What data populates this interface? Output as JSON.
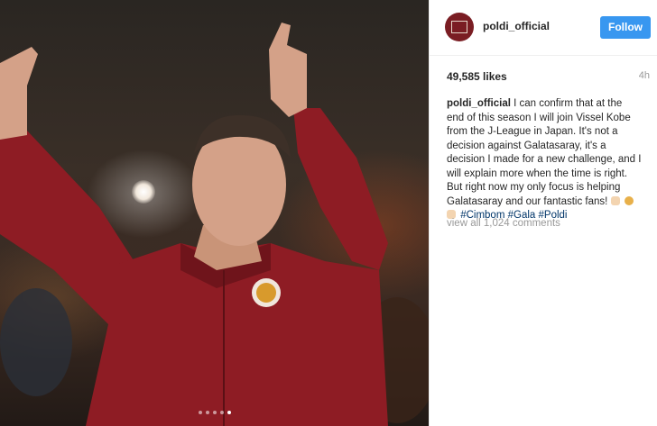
{
  "post": {
    "image_alt": "Man in red Galatasaray track jacket giving two thumbs up in a stadium",
    "carousel_dots": 5,
    "carousel_active": 5
  },
  "header": {
    "username": "poldi_official",
    "follow_label": "Follow"
  },
  "stats": {
    "likes": "49,585 likes",
    "time": "4h"
  },
  "caption": {
    "username": "poldi_official",
    "text": "I can confirm that at the end of this season I will join Vissel Kobe from the J-League in Japan. It's not a decision against Galatasaray, it's a decision I made for a new challenge, and I will explain more when the time is right. But right now my only focus is helping Galatasaray and our fantastic fans!",
    "emojis": [
      "flexed-biceps-emoji",
      "lion-emoji",
      "thumbs-up-emoji"
    ],
    "hashtags": [
      "#Cimbom",
      "#Gala",
      "#Poldi"
    ]
  },
  "comments": {
    "view_all": "view all 1,024 comments"
  },
  "colors": {
    "follow_button": "#3897f0",
    "hashtag": "#003569",
    "jacket": "#8e1c24",
    "muted_text": "#999999"
  }
}
